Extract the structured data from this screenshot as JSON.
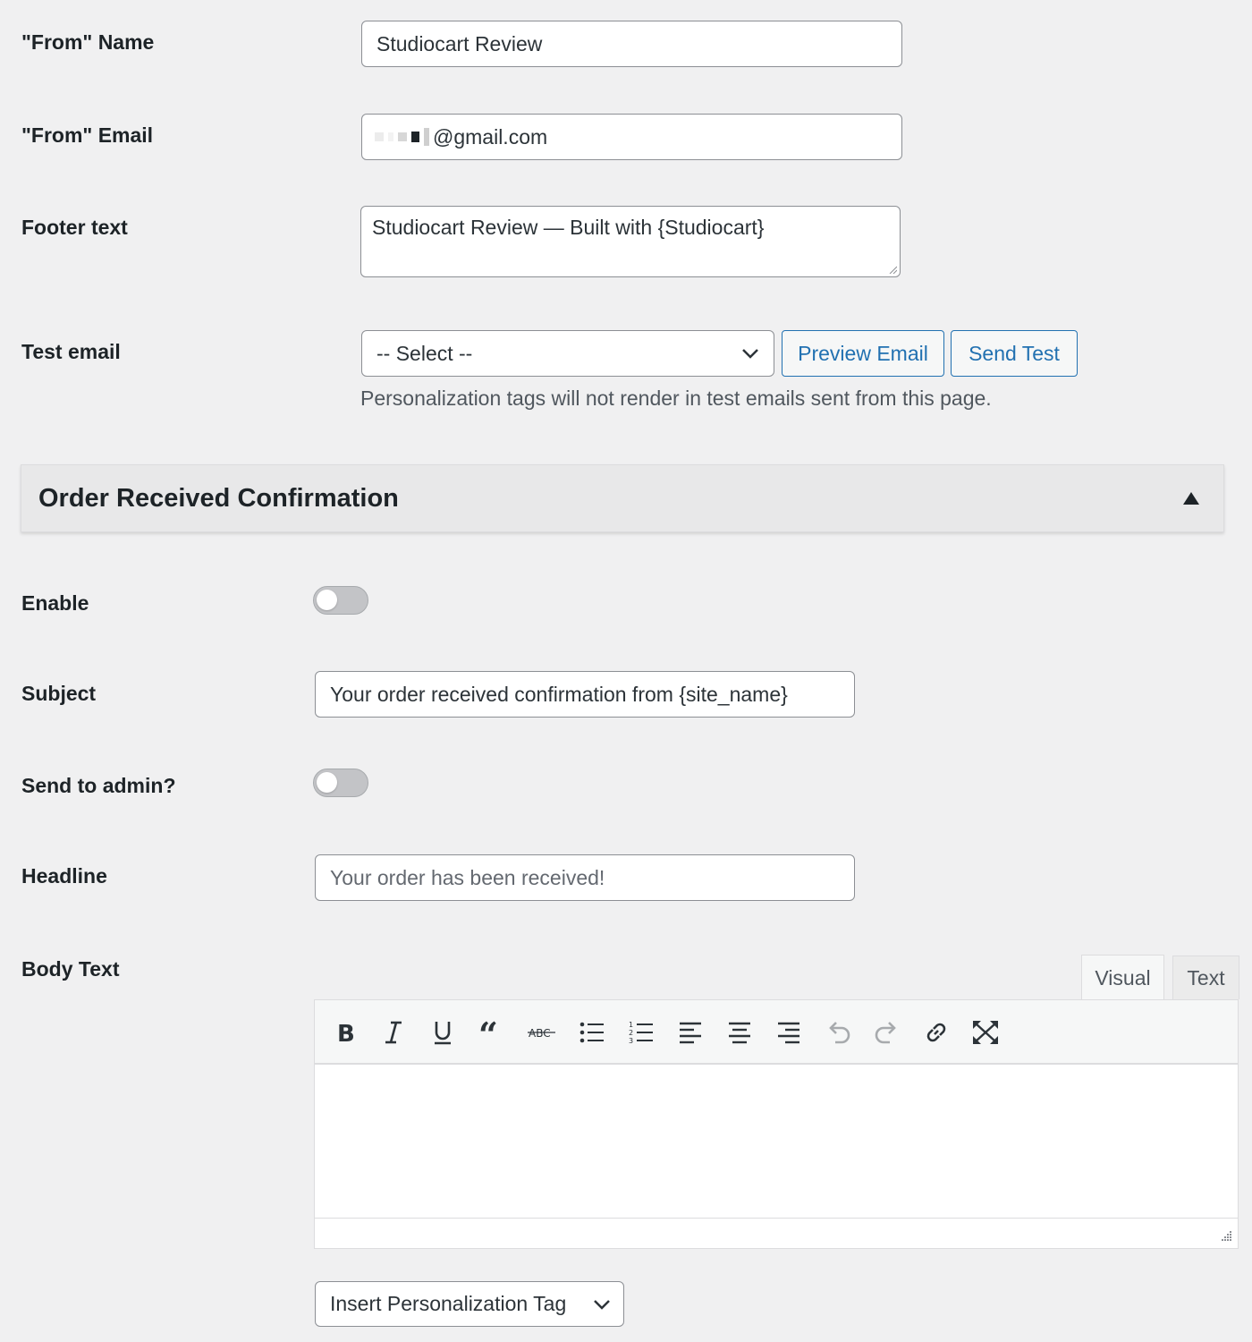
{
  "general": {
    "from_name": {
      "label": "\"From\" Name",
      "value": "Studiocart Review"
    },
    "from_email": {
      "label": "\"From\" Email",
      "value": "@gmail.com"
    },
    "footer_text": {
      "label": "Footer text",
      "value": "Studiocart Review — Built with {Studiocart}"
    },
    "test_email": {
      "label": "Test email",
      "select_value": "-- Select --",
      "preview_label": "Preview Email",
      "send_label": "Send Test",
      "help": "Personalization tags will not render in test emails sent from this page."
    }
  },
  "section": {
    "title": "Order Received Confirmation",
    "toggle_icon": "triangle-up-icon",
    "enable": {
      "label": "Enable",
      "on": false
    },
    "subject": {
      "label": "Subject",
      "value": "Your order received confirmation from {site_name}"
    },
    "send_to_admin": {
      "label": "Send to admin?",
      "on": false
    },
    "headline": {
      "label": "Headline",
      "placeholder": "Your order has been received!"
    },
    "body_text": {
      "label": "Body Text",
      "tabs": [
        "Visual",
        "Text"
      ],
      "active_tab": "Visual",
      "toolbar": [
        "bold-icon",
        "italic-icon",
        "underline-icon",
        "blockquote-icon",
        "strikethrough-icon",
        "bullet-list-icon",
        "numbered-list-icon",
        "align-left-icon",
        "align-center-icon",
        "align-right-icon",
        "undo-icon",
        "redo-icon",
        "link-icon",
        "fullscreen-icon"
      ]
    },
    "insert_tag_label": "Insert Personalization Tag"
  },
  "colors": {
    "background": "#f0f0f1",
    "accent": "#2271b1",
    "text": "#1d2327"
  }
}
